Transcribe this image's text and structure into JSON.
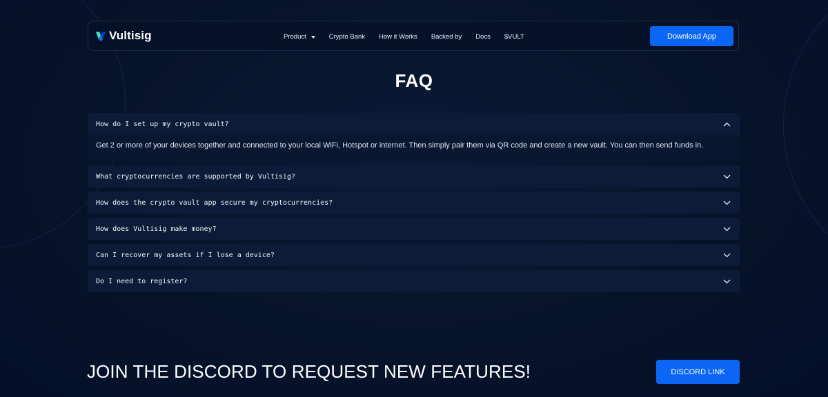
{
  "nav": {
    "brand": "Vultisig",
    "links": [
      "Product",
      "Crypto Bank",
      "How it Works",
      "Backed by",
      "Docs",
      "$VULT"
    ],
    "download_label": "Download App"
  },
  "faq": {
    "title": "FAQ",
    "items": [
      {
        "question": "How do I set up my crypto vault?",
        "answer": "Get 2 or more of your devices together and connected to your local WiFi, Hotspot or internet. Then simply pair them via QR code and create a new vault. You can then send funds in.",
        "expanded": true
      },
      {
        "question": "What cryptocurrencies are supported by Vultisig?",
        "expanded": false
      },
      {
        "question": "How does the crypto vault app secure my cryptocurrencies?",
        "expanded": false
      },
      {
        "question": "How does Vultisig make money?",
        "expanded": false
      },
      {
        "question": "Can I recover my assets if I lose a device?",
        "expanded": false
      },
      {
        "question": "Do I need to register?",
        "expanded": false
      }
    ]
  },
  "cta": {
    "text": "JOIN THE DISCORD TO REQUEST NEW FEATURES!",
    "button_label": "DISCORD LINK"
  },
  "colors": {
    "background": "#061329",
    "accent": "#0b66f5",
    "panel": "#0c1c38",
    "logo_light": "#33e6bf",
    "logo_dark": "#0439c7"
  },
  "icons": {
    "logo": "vultisig-logo-icon",
    "dropdown": "chevron-down-icon",
    "expanded": "chevron-up-icon"
  }
}
